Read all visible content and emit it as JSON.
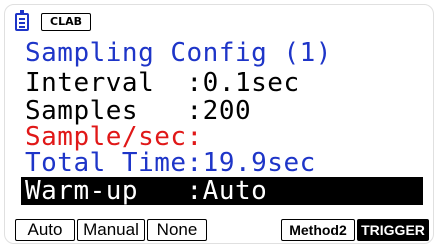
{
  "status": {
    "badge": "CLAB",
    "battery_icon": "battery-icon"
  },
  "title": "Sampling Config (1)",
  "rows": [
    {
      "text": "Interval  :0.1sec",
      "color": "#000000"
    },
    {
      "text": "Samples   :200",
      "color": "#000000"
    },
    {
      "text": "Sample/sec:",
      "color": "#e01818"
    },
    {
      "text": "Total Time:19.9sec",
      "color": "#1e35c8"
    },
    {
      "text": "Warm-up   :Auto",
      "color": "#ffffff",
      "selected": true
    }
  ],
  "function_keys": [
    "Auto",
    "Manual",
    "None",
    "Method2",
    "TRIGGER"
  ],
  "colors": {
    "accent_blue": "#1e35c8",
    "alert_red": "#e01818",
    "highlight": "#000000"
  }
}
